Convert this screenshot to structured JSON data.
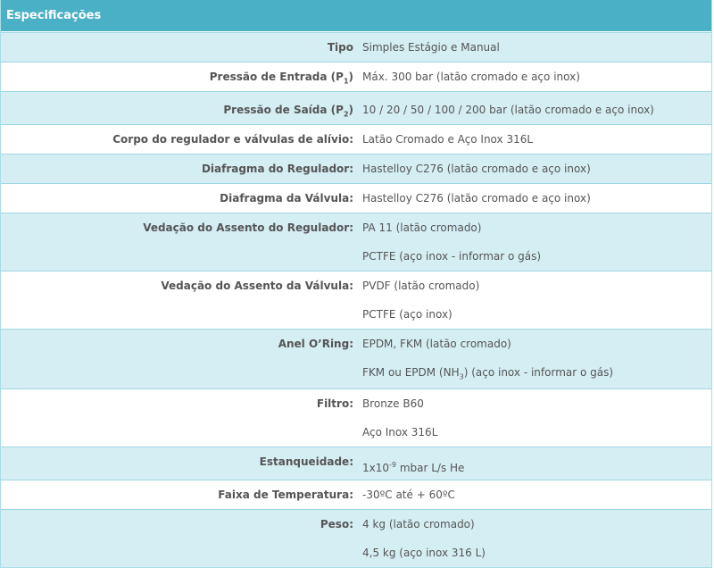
{
  "title": "Especificações",
  "rows": [
    {
      "label": "Tipo",
      "values": [
        "Simples Estágio e Manual"
      ]
    },
    {
      "label": "Pressão de Entrada (P",
      "label_sub": "1",
      "label_tail": ")",
      "values": [
        "Máx. 300 bar (latão cromado e aço inox)"
      ]
    },
    {
      "label": "Pressão de Saída (P",
      "label_sub": "2",
      "label_tail": ")",
      "values": [
        "10 / 20 / 50 / 100 / 200 bar (latão cromado e aço inox)"
      ]
    },
    {
      "label": "Corpo do regulador e válvulas de alívio:",
      "values": [
        "Latão Cromado e Aço Inox 316L"
      ]
    },
    {
      "label": "Diafragma do Regulador:",
      "values": [
        "Hastelloy C276 (latão cromado e aço inox)"
      ]
    },
    {
      "label": "Diafragma da Válvula:",
      "values": [
        "Hastelloy C276 (latão cromado e aço inox)"
      ]
    },
    {
      "label": "Vedação do Assento do Regulador:",
      "values": [
        "PA 11 (latão cromado)",
        "PCTFE (aço inox - informar o gás)"
      ]
    },
    {
      "label": "Vedação do Assento da Válvula:",
      "values": [
        "PVDF (latão cromado)",
        "PCTFE (aço inox)"
      ]
    },
    {
      "label": "Anel O’Ring:",
      "values": [
        "EPDM, FKM (latão cromado)"
      ],
      "value2_pre": "FKM ou EPDM (NH",
      "value2_sub": "3",
      "value2_post": ") (aço inox - informar o gás)"
    },
    {
      "label": "Filtro:",
      "values": [
        "Bronze B60",
        "Aço Inox 316L"
      ]
    },
    {
      "label": "Estanqueidade:",
      "value_pre": "1x10",
      "value_sup": "-9",
      "value_post": " mbar L/s He"
    },
    {
      "label": "Faixa de Temperatura:",
      "values": [
        "-30ºC até + 60ºC"
      ]
    },
    {
      "label": "Peso:",
      "values": [
        "4 kg (latão cromado)",
        "4,5 kg (aço inox 316 L)"
      ]
    }
  ]
}
